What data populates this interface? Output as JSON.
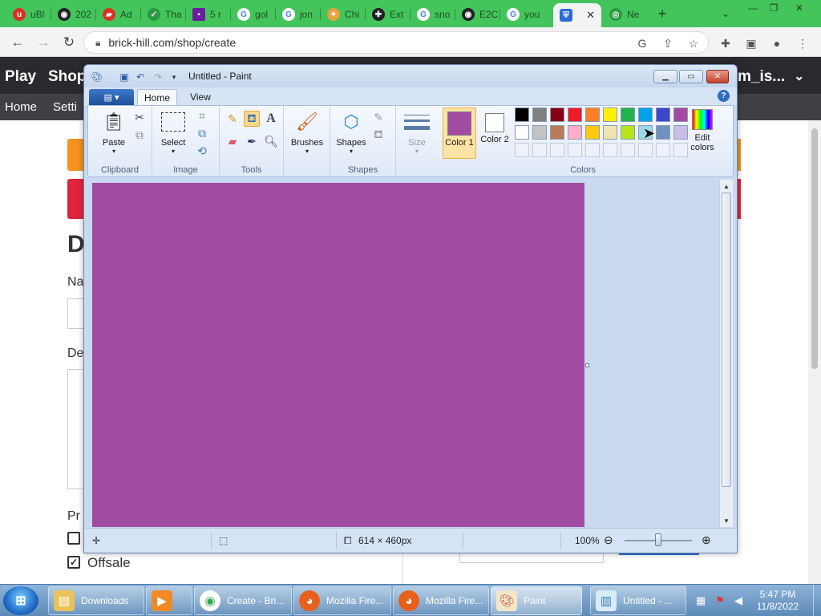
{
  "browser": {
    "tabs": [
      {
        "label": "uBl",
        "icon": "ublock-icon",
        "color": "#d93025"
      },
      {
        "label": "202",
        "icon": "globe-icon",
        "color": "#202124"
      },
      {
        "label": "Ad",
        "icon": "bookmark-icon",
        "color": "#d93025"
      },
      {
        "label": "Tha",
        "icon": "check-icon",
        "color": "#43c55b"
      },
      {
        "label": "5 r",
        "icon": "app-icon",
        "color": "#6b1fa0"
      },
      {
        "label": "gol",
        "icon": "google-icon",
        "color": "#4285f4"
      },
      {
        "label": "jon",
        "icon": "google-icon",
        "color": "#4285f4"
      },
      {
        "label": "Chi",
        "icon": "puzzle-piece-icon",
        "color": "#e8a33d"
      },
      {
        "label": "Ext",
        "icon": "puzzle-piece-icon",
        "color": "#202124"
      },
      {
        "label": "sno",
        "icon": "google-icon",
        "color": "#4285f4"
      },
      {
        "label": "E2C",
        "icon": "globe-icon",
        "color": "#202124"
      },
      {
        "label": "you",
        "icon": "google-icon",
        "color": "#4285f4"
      }
    ],
    "active_tab": {
      "label": "",
      "icon": "shield-icon"
    },
    "last_tab": {
      "label": "Ne",
      "icon": "chrome-icon"
    },
    "url": "brick-hill.com/shop/create"
  },
  "website": {
    "nav": {
      "play": "Play",
      "shop": "Shop",
      "user": "m_is..."
    },
    "subnav": {
      "home": "Home",
      "settings": "Setti"
    },
    "heading_initial": "D",
    "name_label": "Na",
    "description_label": "De",
    "price_label": "Pr",
    "offsale_label": "Offsale"
  },
  "paint": {
    "title": "Untitled - Paint",
    "tabs": {
      "home": "Home",
      "view": "View"
    },
    "groups": {
      "clipboard": "Clipboard",
      "image": "Image",
      "tools": "Tools",
      "shapes": "Shapes",
      "colors": "Colors"
    },
    "buttons": {
      "paste": "Paste",
      "select": "Select",
      "brushes": "Brushes",
      "shapes": "Shapes",
      "size": "Size",
      "color1": "Color 1",
      "color2": "Color 2",
      "edit_colors_line1": "Edit",
      "edit_colors_line2": "colors"
    },
    "color1_value": "#a24ba3",
    "color2_value": "#ffffff",
    "palette_row1": [
      "#000000",
      "#7f7f7f",
      "#880015",
      "#ed1c24",
      "#ff7f27",
      "#fff200",
      "#22b14c",
      "#00a2e8",
      "#3f48cc",
      "#a349a4"
    ],
    "palette_row2": [
      "#ffffff",
      "#c3c3c3",
      "#b97a57",
      "#ffaec9",
      "#ffc90e",
      "#efe4b0",
      "#b5e61d",
      "#99d9ea",
      "#7092be",
      "#c8bfe7"
    ],
    "canvas_color": "#a24ba3",
    "status": {
      "dimensions": "614 × 460px",
      "zoom": "100%"
    }
  },
  "taskbar": {
    "items": [
      {
        "label": "Downloads",
        "icon": "folder-icon"
      },
      {
        "label": "",
        "icon": "media-player-icon"
      },
      {
        "label": "Create - Bri...",
        "icon": "chrome-icon"
      },
      {
        "label": "Mozilla Fire...",
        "icon": "firefox-icon"
      },
      {
        "label": "Mozilla Fire...",
        "icon": "firefox-icon"
      },
      {
        "label": "Paint",
        "icon": "paint-palette-icon"
      },
      {
        "label": "Untitled - ...",
        "icon": "notepad-icon"
      }
    ],
    "time": "5:47 PM",
    "date": "11/8/2022"
  }
}
